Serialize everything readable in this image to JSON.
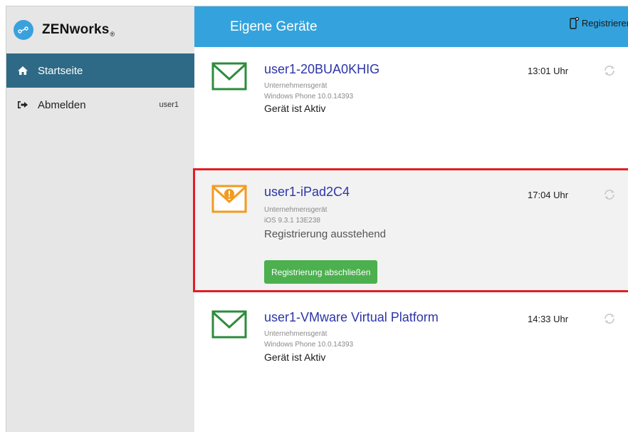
{
  "brand": {
    "name": "ZENworks",
    "mark": "®"
  },
  "sidebar": {
    "items": [
      {
        "label": "Startseite",
        "icon": "home-icon",
        "active": true
      },
      {
        "label": "Abmelden",
        "icon": "sign-out-icon",
        "user": "user1"
      }
    ]
  },
  "header": {
    "title": "Eigene Geräte",
    "register_label": "Registrieren"
  },
  "devices": [
    {
      "name": "user1-20BUA0KHIG",
      "type": "Unternehmensgerät",
      "os": "Windows Phone 10.0.14393",
      "status": "Gerät ist Aktiv",
      "time": "13:01 Uhr",
      "icon": "envelope-icon",
      "icon_color": "#2e8b3d"
    },
    {
      "name": "user1-iPad2C4",
      "type": "Unternehmensgerät",
      "os": "iOS 9.3.1 13E238",
      "status": "Registrierung ausstehend",
      "time": "17:04 Uhr",
      "icon": "envelope-warning-icon",
      "icon_color": "#f39a1e",
      "action_label": "Registrierung abschließen"
    },
    {
      "name": "user1-VMware Virtual Platform",
      "type": "Unternehmensgerät",
      "os": "Windows Phone 10.0.14393",
      "status": "Gerät ist Aktiv",
      "time": "14:33 Uhr",
      "icon": "envelope-icon",
      "icon_color": "#2e8b3d"
    }
  ],
  "colors": {
    "header": "#34a3dd",
    "sidebar_active": "#2e6a86",
    "highlight": "#e31e24",
    "button": "#4cb04f",
    "device_name": "#2d35a8"
  }
}
